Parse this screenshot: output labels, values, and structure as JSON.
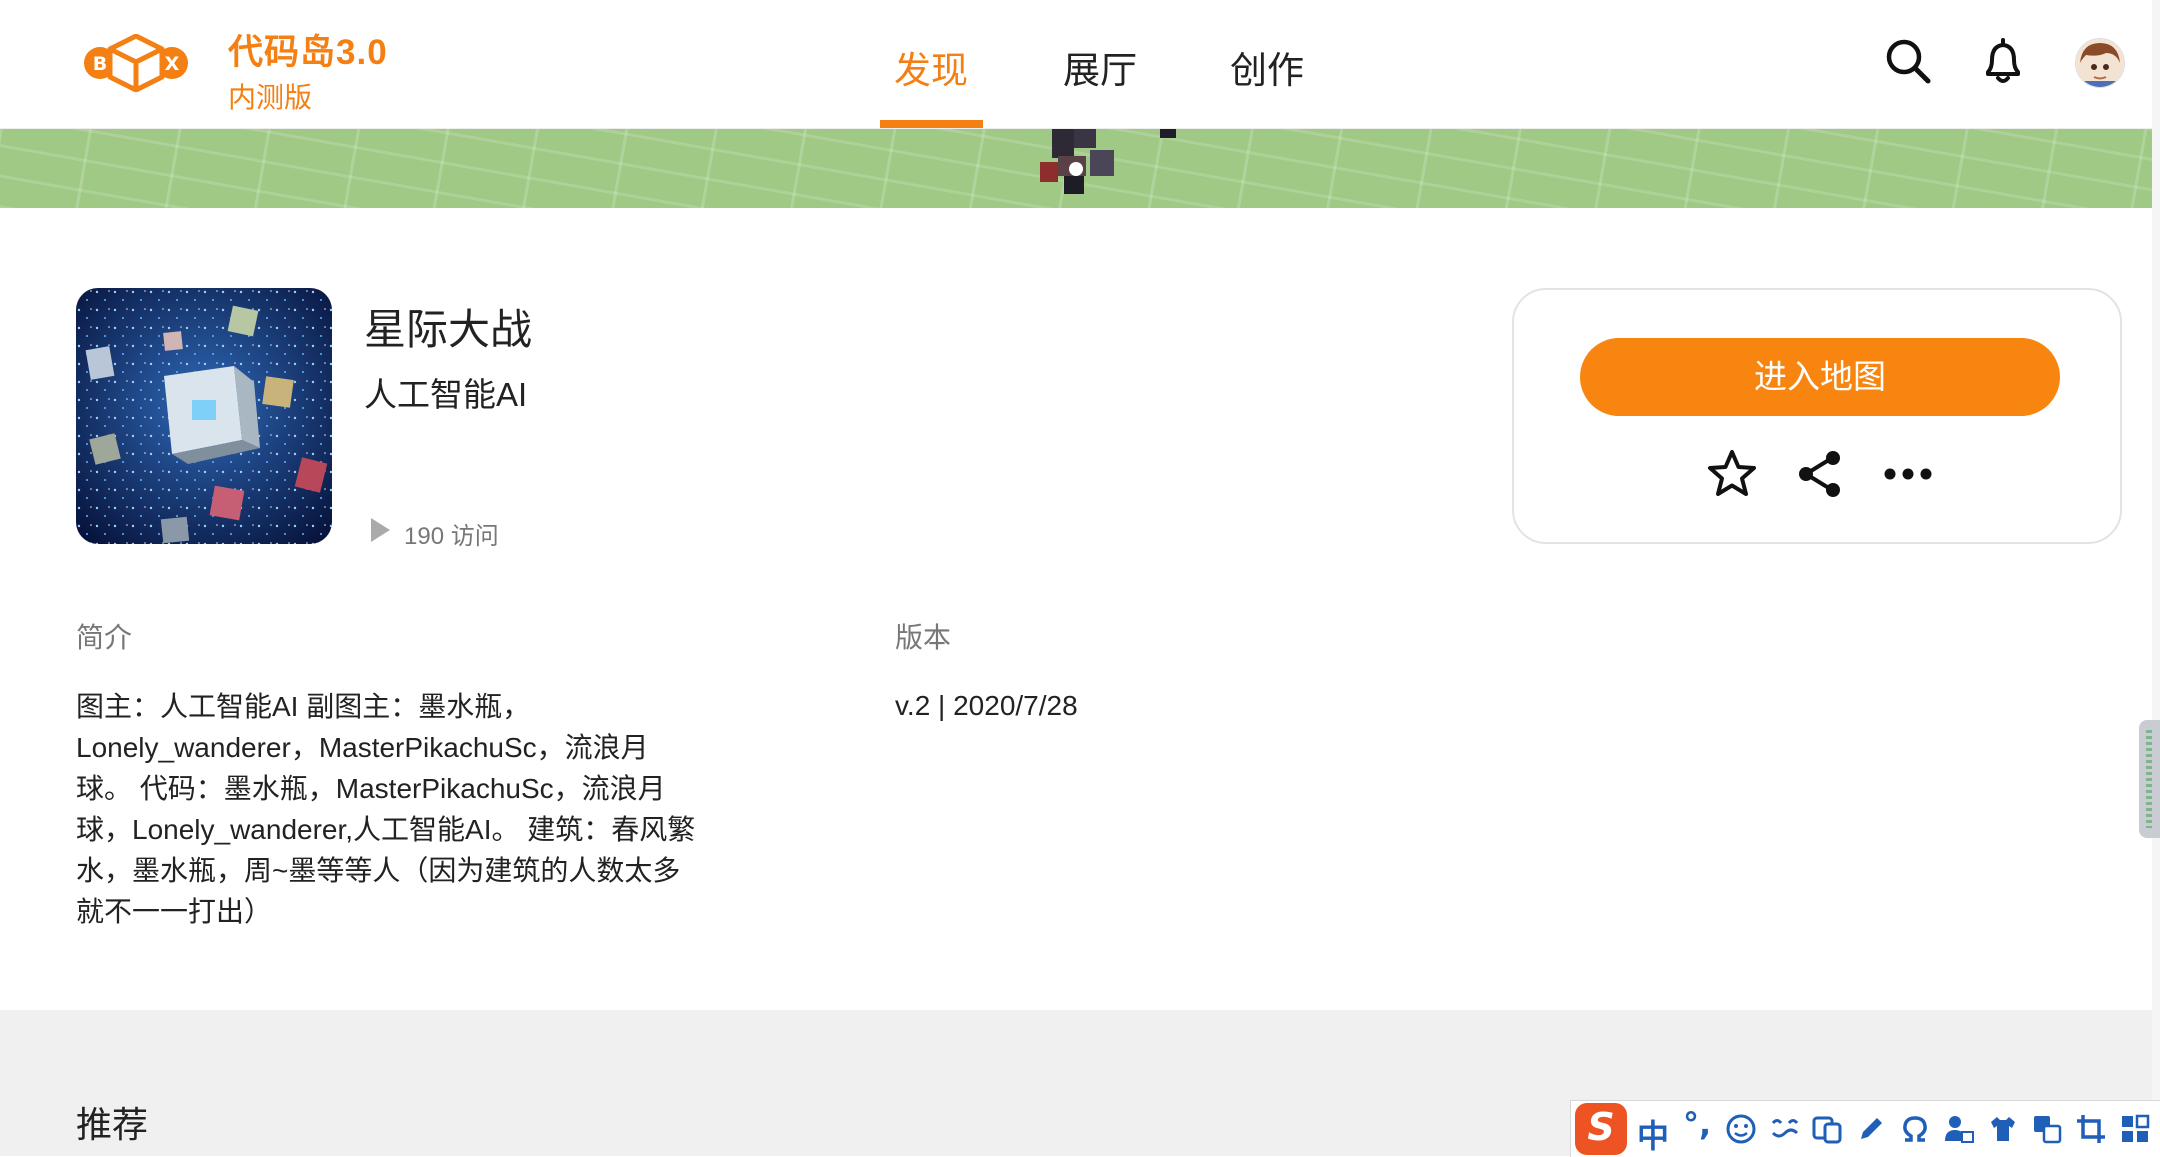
{
  "header": {
    "logo": {
      "letter_left": "B",
      "letter_right": "X"
    },
    "title": "代码岛3.0",
    "subtitle": "内测版",
    "nav": [
      {
        "label": "发现",
        "active": true
      },
      {
        "label": "展厅",
        "active": false
      },
      {
        "label": "创作",
        "active": false
      }
    ],
    "icons": [
      "search-icon",
      "bell-icon",
      "avatar"
    ]
  },
  "map": {
    "title": "星际大战",
    "author": "人工智能AI",
    "visits": "190 访问"
  },
  "actions": {
    "enter_label": "进入地图",
    "icons": [
      "star-icon",
      "share-icon",
      "more-icon"
    ]
  },
  "details": {
    "intro_label": "简介",
    "intro_text": "图主：人工智能AI 副图主：墨水瓶，Lonely_wanderer，MasterPikachuSc，流浪月球。 代码：墨水瓶，MasterPikachuSc，流浪月球，Lonely_wanderer,人工智能AI。 建筑：春风繁水，墨水瓶，周~墨等等人（因为建筑的人数太多就不一一打出）",
    "version_label": "版本",
    "version_text": "v.2 | 2020/7/28"
  },
  "recommend": {
    "title": "推荐"
  },
  "ime_toolbar": {
    "logo": "S",
    "mode": "中",
    "punct": "°,",
    "icons": [
      "emoji-icon",
      "voice-icon",
      "screen-icon",
      "pen-icon",
      "omega-icon",
      "user-icon",
      "shirt-icon",
      "translate-icon",
      "crop-icon",
      "grid-icon"
    ]
  },
  "colors": {
    "brand": "#f47f12",
    "button": "#f8850f",
    "banner": "#9fc985",
    "gray_section": "#f0f0f0",
    "ime_blue": "#1f5fb7",
    "ime_logo": "#ee5423"
  }
}
